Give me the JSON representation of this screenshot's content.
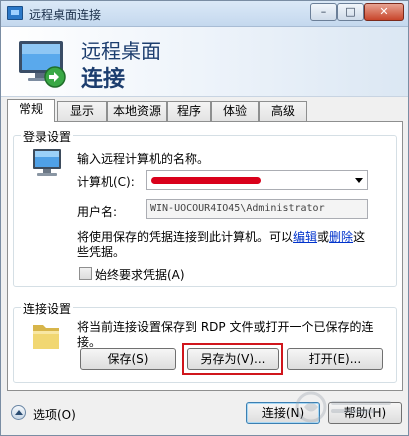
{
  "window": {
    "title": "远程桌面连接",
    "minimize_glyph": "–",
    "maximize_glyph": "□",
    "close_glyph": "✕"
  },
  "banner": {
    "line1": "远程桌面",
    "line2": "连接"
  },
  "tabs": [
    {
      "label": "常规",
      "active": true
    },
    {
      "label": "显示",
      "active": false
    },
    {
      "label": "本地资源",
      "active": false
    },
    {
      "label": "程序",
      "active": false
    },
    {
      "label": "体验",
      "active": false
    },
    {
      "label": "高级",
      "active": false
    }
  ],
  "login": {
    "group_label": "登录设置",
    "instruction": "输入远程计算机的名称。",
    "computer_label": "计算机(C):",
    "computer_value": "",
    "username_label": "用户名:",
    "username_value": "WIN-UOCOUR4IO45\\Administrator",
    "saved_line1_pre": "将使用保存的凭据连接到此计算机。可以",
    "saved_edit_link": "编辑",
    "saved_or": "或",
    "saved_delete_link": "删除",
    "saved_line1_post": "这",
    "saved_line2": "些凭据。",
    "always_ask_label": "始终要求凭据(A)",
    "always_ask_checked": false
  },
  "connection": {
    "group_label": "连接设置",
    "description_line1": "将当前连接设置保存到 RDP 文件或打开一个已保存的连",
    "description_line2": "接。",
    "save_label": "保存(S)",
    "save_as_label": "另存为(V)...",
    "open_label": "打开(E)..."
  },
  "footer": {
    "options_label": "选项(O)",
    "connect_label": "连接(N)",
    "help_label": "帮助(H)"
  },
  "colors": {
    "title_text": "#1b2f4a",
    "banner_text": "#1c3d6e",
    "link": "#0033cc",
    "highlight": "#d0161c",
    "redaction": "#d9001b"
  }
}
